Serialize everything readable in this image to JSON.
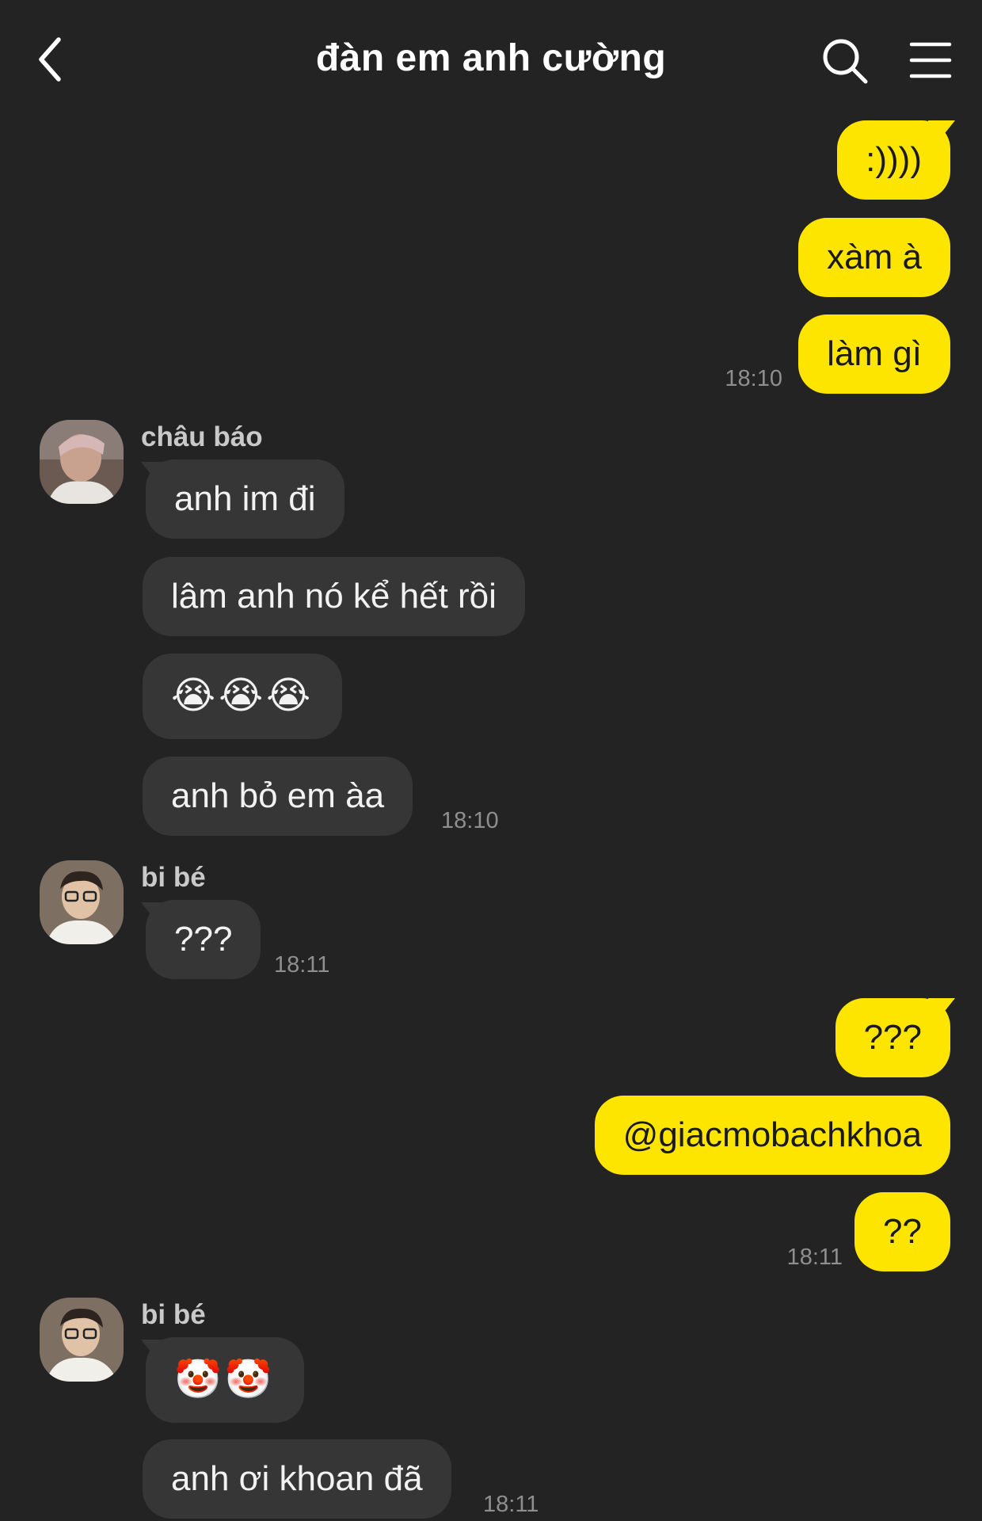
{
  "header": {
    "title": "đàn em anh cường",
    "back_icon": "chevron-left-icon",
    "search_icon": "search-icon",
    "menu_icon": "hamburger-menu-icon"
  },
  "colors": {
    "background": "#232323",
    "my_bubble": "#fee500",
    "other_bubble": "#363636",
    "timestamp": "#8f8f8f"
  },
  "messages": {
    "m1": ":))))",
    "m2": "xàm à",
    "m3": "làm gì",
    "t1": "18:10",
    "sender1": "châu báo",
    "m4": "anh im đi",
    "m5": "lâm anh nó kể hết rồi",
    "m6": "😭😭😭",
    "m7": "anh bỏ em àa",
    "t2": "18:10",
    "sender2": "bi bé",
    "m8": "???",
    "t3": "18:11",
    "m9": "???",
    "m10": "@giacmobachkhoa",
    "m11": "??",
    "t4": "18:11",
    "sender3": "bi bé",
    "m12": "🤡🤡",
    "m13": "anh ơi khoan đã",
    "t5": "18:11"
  }
}
